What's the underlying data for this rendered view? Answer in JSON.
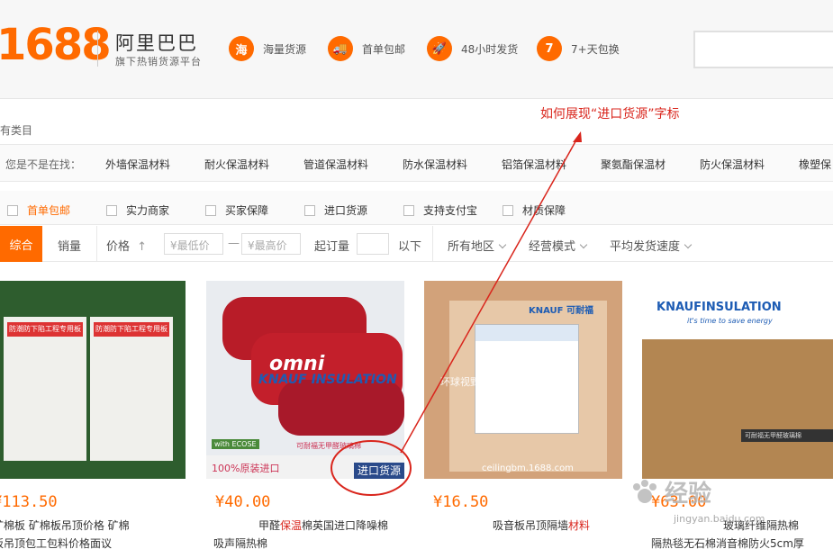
{
  "header": {
    "logo": "1688",
    "brand_name": "阿里巴巴",
    "brand_sub": "旗下热销货源平台",
    "features": [
      {
        "icon": "海",
        "label": "海量货源"
      },
      {
        "icon": "🚚",
        "label": "首单包邮"
      },
      {
        "icon": "🚀",
        "label": "48小时发货"
      },
      {
        "icon": "7",
        "label": "7+天包换"
      }
    ]
  },
  "annotation": "如何展现“进口货源”字标",
  "all_categories": "有类目",
  "suggest": {
    "label": "您是不是在找：",
    "items": [
      "外墙保温材料",
      "耐火保温材料",
      "管道保温材料",
      "防水保温材料",
      "铝箔保温材料",
      "聚氨酯保温材",
      "防火保温材料",
      "橡塑保"
    ]
  },
  "filters": [
    "首单包邮",
    "实力商家",
    "买家保障",
    "进口货源",
    "支持支付宝",
    "材质保障"
  ],
  "sort": {
    "active": "综合",
    "sales": "销量",
    "price": "价格",
    "price_up_icon": "↑",
    "min_price": "¥最低价",
    "dash": "—",
    "max_price": "¥最高价",
    "moq": "起订量",
    "below": "以下",
    "region": "所有地区",
    "mode": "经营模式",
    "speed": "平均发货速度"
  },
  "products": [
    {
      "price": "¥113.50",
      "title_a": "矿棉板 矿棉板吊顶价格 矿棉",
      "title_b": "板吊顶包工包料价格面议",
      "img_label": "防潮防下陷工程专用板"
    },
    {
      "price": "¥40.00",
      "title_pre": "甲醛",
      "title_hl": "保温",
      "title_post": "棉英国进口降噪棉",
      "title_b": "吸声隔热棉",
      "img_omni": "omni",
      "img_knauf": "KNAUF INSULATION",
      "img_100": "100%原装进口",
      "img_badge": "进口货源",
      "img_ecose": "with ECOSE",
      "img_slogan": "可耐福无甲醛玻璃棉"
    },
    {
      "price": "¥16.50",
      "title_pre": "吸音板吊顶隔墙",
      "title_hl": "材料",
      "title_b": "",
      "img_brand": "KNAUF 可耐福",
      "img_wm": "环球视野 · 中国 · 材料有限公司",
      "img_site": "ceilingbm.1688.com"
    },
    {
      "price": "¥63.00",
      "title_pre": "玻璃纤维隔热棉",
      "title_hl": "",
      "title_b": "隔热毯无石棉消音棉防火5cm厚",
      "img_brand": "KNAUFINSULATION",
      "img_tag": "it's time to save energy",
      "img_strip": "可耐福无甲醛玻璃棉"
    }
  ],
  "watermark": {
    "text": "经验",
    "url": "jingyan.baidu.com"
  },
  "colors": {
    "accent": "#ff6a00",
    "annotation": "#d9251c"
  }
}
